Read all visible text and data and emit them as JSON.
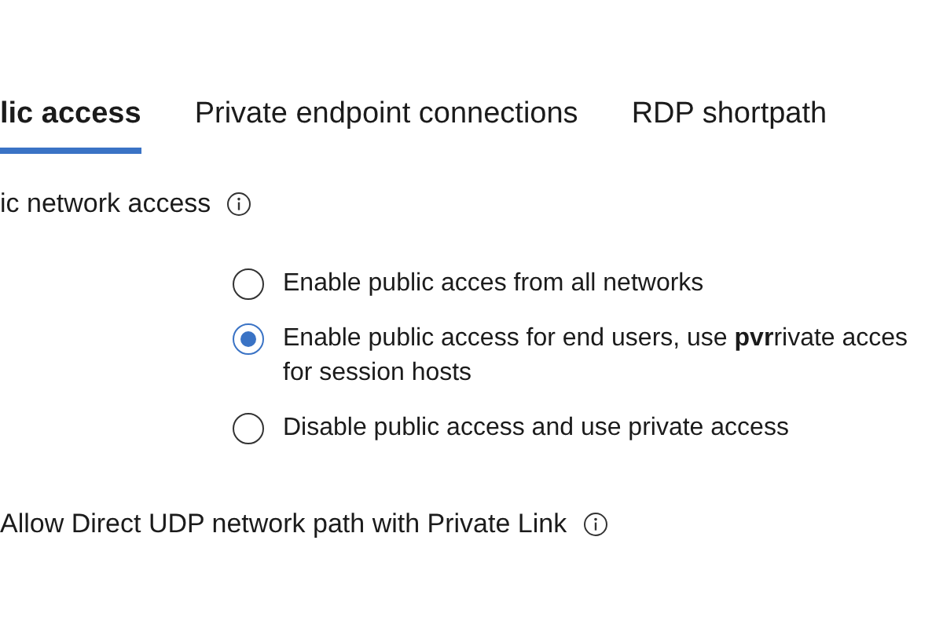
{
  "tabs": [
    {
      "label": "lic access",
      "selected": true
    },
    {
      "label": "Private endpoint connections",
      "selected": false
    },
    {
      "label": "RDP shortpath",
      "selected": false
    }
  ],
  "public_network_access": {
    "label": "ic network access",
    "options": [
      {
        "label": "Enable public acces from all networks",
        "selected": false
      },
      {
        "label": "Enable public access for end users, use **pvr**rivate acces for session hosts",
        "selected": true
      },
      {
        "label": "Disable public access and use private access",
        "selected": false
      }
    ]
  },
  "direct_udp": {
    "label": "Allow Direct UDP network path with Private Link"
  }
}
